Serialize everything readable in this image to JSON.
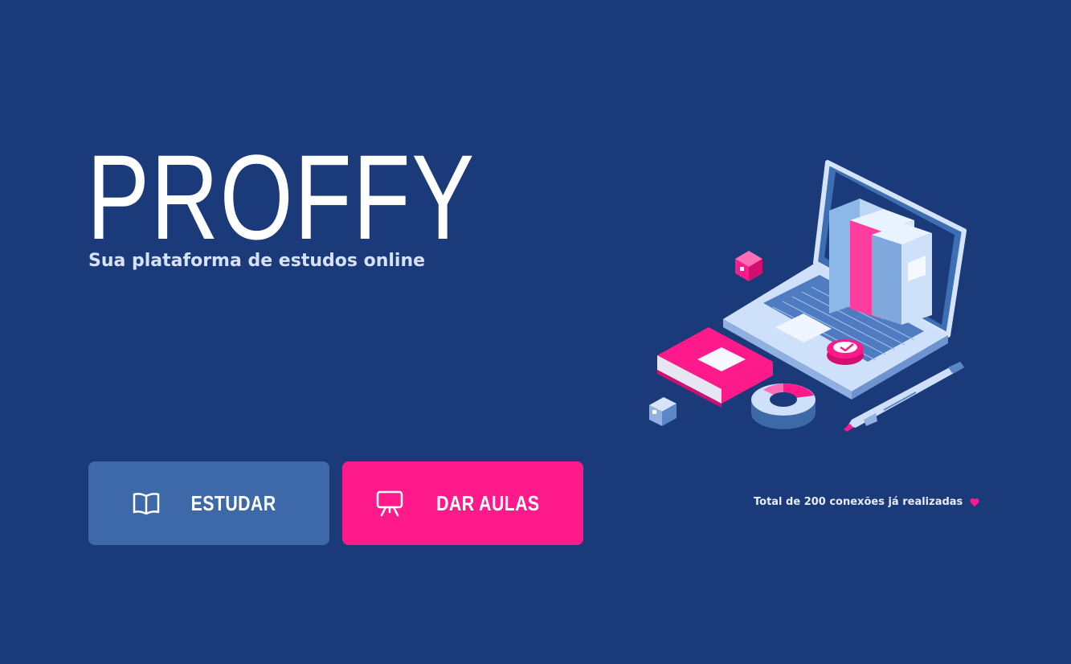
{
  "brand": {
    "name": "PROFFY",
    "tagline": "Sua plataforma de estudos online"
  },
  "hero": {
    "icon": "laptop-study-illustration"
  },
  "actions": {
    "study_label": "ESTUDAR",
    "study_icon": "open-book-icon",
    "teach_label": "DAR AULAS",
    "teach_icon": "presentation-board-icon"
  },
  "footer": {
    "total_connections": "Total de 200 conexões já realizadas",
    "heart_icon": "heart-icon"
  },
  "colors": {
    "background": "#1a3a7a",
    "study_button": "#3d69a8",
    "teach_button": "#ff1a8c",
    "heart": "#ff1a8c"
  }
}
